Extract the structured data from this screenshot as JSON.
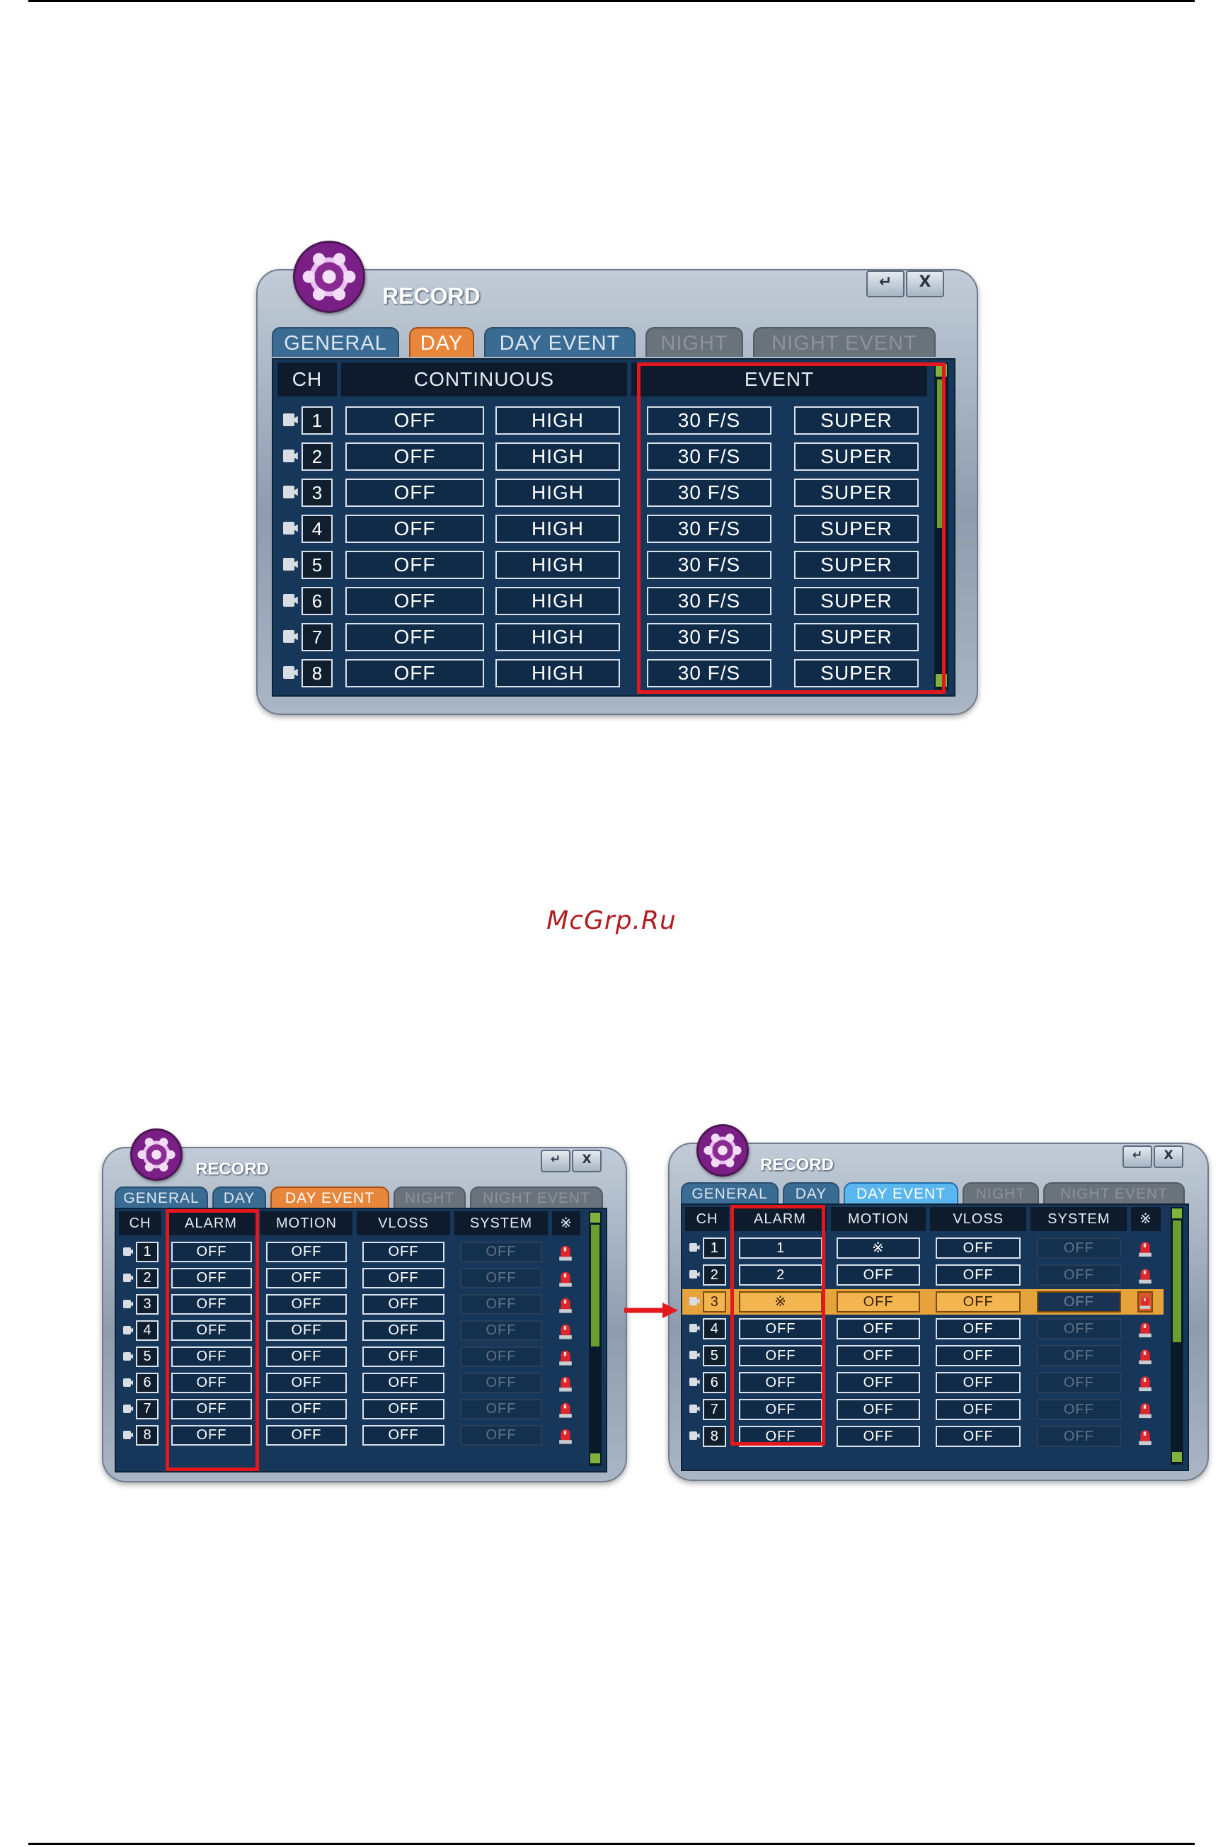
{
  "watermark": "McGrp.Ru",
  "win1": {
    "title": "RECORD",
    "enter_btn": "↵",
    "close_btn": "X",
    "tabs": [
      {
        "label": "GENERAL",
        "state": "normal"
      },
      {
        "label": "DAY",
        "state": "active"
      },
      {
        "label": "DAY EVENT",
        "state": "normal"
      },
      {
        "label": "NIGHT",
        "state": "disabled"
      },
      {
        "label": "NIGHT EVENT",
        "state": "disabled"
      }
    ],
    "headers": {
      "ch": "CH",
      "continuous": "CONTINUOUS",
      "event": "EVENT"
    },
    "rows": [
      {
        "ch": "1",
        "cont_rate": "OFF",
        "cont_quality": "HIGH",
        "event_rate": "30 F/S",
        "event_quality": "SUPER"
      },
      {
        "ch": "2",
        "cont_rate": "OFF",
        "cont_quality": "HIGH",
        "event_rate": "30 F/S",
        "event_quality": "SUPER"
      },
      {
        "ch": "3",
        "cont_rate": "OFF",
        "cont_quality": "HIGH",
        "event_rate": "30 F/S",
        "event_quality": "SUPER"
      },
      {
        "ch": "4",
        "cont_rate": "OFF",
        "cont_quality": "HIGH",
        "event_rate": "30 F/S",
        "event_quality": "SUPER"
      },
      {
        "ch": "5",
        "cont_rate": "OFF",
        "cont_quality": "HIGH",
        "event_rate": "30 F/S",
        "event_quality": "SUPER"
      },
      {
        "ch": "6",
        "cont_rate": "OFF",
        "cont_quality": "HIGH",
        "event_rate": "30 F/S",
        "event_quality": "SUPER"
      },
      {
        "ch": "7",
        "cont_rate": "OFF",
        "cont_quality": "HIGH",
        "event_rate": "30 F/S",
        "event_quality": "SUPER"
      },
      {
        "ch": "8",
        "cont_rate": "OFF",
        "cont_quality": "HIGH",
        "event_rate": "30 F/S",
        "event_quality": "SUPER"
      }
    ]
  },
  "win2": {
    "title": "RECORD",
    "enter_btn": "↵",
    "close_btn": "X",
    "tabs": [
      {
        "label": "GENERAL",
        "state": "normal"
      },
      {
        "label": "DAY",
        "state": "normal"
      },
      {
        "label": "DAY EVENT",
        "state": "active"
      },
      {
        "label": "NIGHT",
        "state": "disabled"
      },
      {
        "label": "NIGHT EVENT",
        "state": "disabled"
      }
    ],
    "headers": {
      "ch": "CH",
      "alarm": "ALARM",
      "motion": "MOTION",
      "vloss": "VLOSS",
      "system": "SYSTEM",
      "all": "※"
    },
    "rows": [
      {
        "ch": "1",
        "alarm": "OFF",
        "motion": "OFF",
        "vloss": "OFF",
        "system": "OFF"
      },
      {
        "ch": "2",
        "alarm": "OFF",
        "motion": "OFF",
        "vloss": "OFF",
        "system": "OFF"
      },
      {
        "ch": "3",
        "alarm": "OFF",
        "motion": "OFF",
        "vloss": "OFF",
        "system": "OFF"
      },
      {
        "ch": "4",
        "alarm": "OFF",
        "motion": "OFF",
        "vloss": "OFF",
        "system": "OFF"
      },
      {
        "ch": "5",
        "alarm": "OFF",
        "motion": "OFF",
        "vloss": "OFF",
        "system": "OFF"
      },
      {
        "ch": "6",
        "alarm": "OFF",
        "motion": "OFF",
        "vloss": "OFF",
        "system": "OFF"
      },
      {
        "ch": "7",
        "alarm": "OFF",
        "motion": "OFF",
        "vloss": "OFF",
        "system": "OFF"
      },
      {
        "ch": "8",
        "alarm": "OFF",
        "motion": "OFF",
        "vloss": "OFF",
        "system": "OFF"
      }
    ]
  },
  "win3": {
    "title": "RECORD",
    "enter_btn": "↵",
    "close_btn": "X",
    "tabs": [
      {
        "label": "GENERAL",
        "state": "normal"
      },
      {
        "label": "DAY",
        "state": "normal"
      },
      {
        "label": "DAY EVENT",
        "state": "active-blue"
      },
      {
        "label": "NIGHT",
        "state": "disabled"
      },
      {
        "label": "NIGHT EVENT",
        "state": "disabled"
      }
    ],
    "headers": {
      "ch": "CH",
      "alarm": "ALARM",
      "motion": "MOTION",
      "vloss": "VLOSS",
      "system": "SYSTEM",
      "all": "※"
    },
    "highlight_row": 3,
    "rows": [
      {
        "ch": "1",
        "alarm": "1",
        "motion": "※",
        "vloss": "OFF",
        "system": "OFF"
      },
      {
        "ch": "2",
        "alarm": "2",
        "motion": "OFF",
        "vloss": "OFF",
        "system": "OFF"
      },
      {
        "ch": "3",
        "alarm": "※",
        "motion": "OFF",
        "vloss": "OFF",
        "system": "OFF"
      },
      {
        "ch": "4",
        "alarm": "OFF",
        "motion": "OFF",
        "vloss": "OFF",
        "system": "OFF"
      },
      {
        "ch": "5",
        "alarm": "OFF",
        "motion": "OFF",
        "vloss": "OFF",
        "system": "OFF"
      },
      {
        "ch": "6",
        "alarm": "OFF",
        "motion": "OFF",
        "vloss": "OFF",
        "system": "OFF"
      },
      {
        "ch": "7",
        "alarm": "OFF",
        "motion": "OFF",
        "vloss": "OFF",
        "system": "OFF"
      },
      {
        "ch": "8",
        "alarm": "OFF",
        "motion": "OFF",
        "vloss": "OFF",
        "system": "OFF"
      }
    ]
  },
  "colors": {
    "annotation_red": "#e4171c",
    "active_tab": "#e8873b",
    "active_tab_blue": "#5ab7ee",
    "highlight_row": "#e7a33b"
  }
}
